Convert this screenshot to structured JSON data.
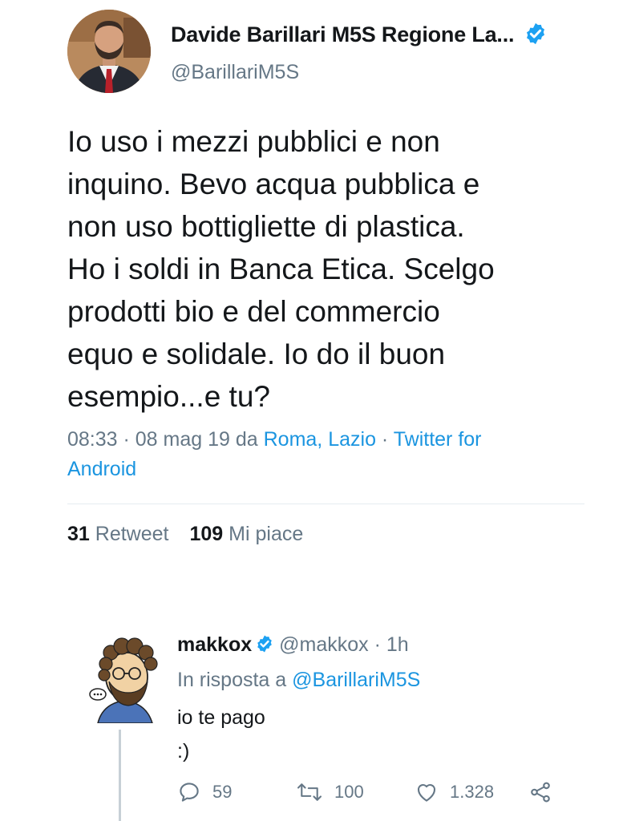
{
  "tweet": {
    "author_name": "Davide Barillari M5S Regione La...",
    "author_handle": "@BarillariM5S",
    "text_lines": [
      "Io uso i mezzi pubblici e non",
      "inquino. Bevo acqua pubblica e",
      "non uso bottigliette di plastica.",
      "Ho i soldi in Banca Etica. Scelgo",
      "prodotti bio e del commercio",
      "equo e solidale. Io do il buon",
      "esempio...e tu?"
    ],
    "time": "08:33",
    "separator": " · ",
    "date": "08 mag 19",
    "location_prefix": " da ",
    "location": "Roma, Lazio",
    "client_line1": "Twitter for",
    "client_line2": "Android",
    "retweet_count": "31",
    "retweet_label": "Retweet",
    "like_count": "109",
    "like_label": "Mi piace"
  },
  "reply": {
    "author_name": "makkox",
    "author_handle": "@makkox",
    "time_sep": " · ",
    "time": "1h",
    "reply_to_prefix": "In risposta a ",
    "reply_to_handle": "@BarillariM5S",
    "text_line1": "io te pago",
    "text_line2": ":)",
    "reply_count": "59",
    "retweet_count": "100",
    "like_count": "1.328"
  },
  "icons": {
    "verified": "verified-badge-icon",
    "reply": "speech-bubble-icon",
    "retweet": "retweet-arrows-icon",
    "like": "heart-outline-icon",
    "share": "share-nodes-icon"
  },
  "colors": {
    "link": "#1b95e0",
    "muted": "#657786",
    "text": "#14171a",
    "verified": "#1da1f2"
  }
}
